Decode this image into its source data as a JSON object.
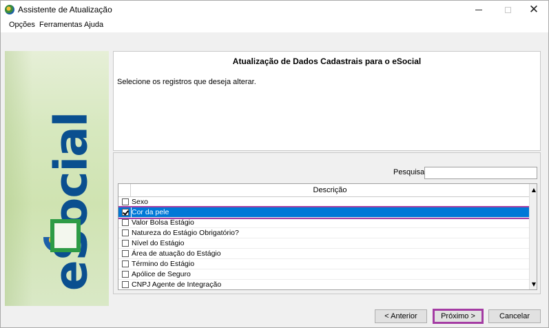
{
  "window": {
    "title": "Assistente de Atualização",
    "minimize": "—",
    "maximize": "",
    "close": "✕"
  },
  "menu": {
    "items": [
      "Opções",
      "Ferramentas",
      "Ajuda"
    ]
  },
  "banner": {
    "logo_text": "eSocial"
  },
  "info": {
    "title": "Atualização de Dados Cadastrais para o eSocial",
    "subtitle": "Selecione os registros que deseja alterar."
  },
  "search": {
    "label": "Pesquisa:",
    "value": ""
  },
  "grid": {
    "column_header": "Descrição",
    "rows": [
      {
        "label": "Sexo",
        "checked": false,
        "selected": false
      },
      {
        "label": "Cor da pele",
        "checked": true,
        "selected": true
      },
      {
        "label": "Valor Bolsa Estágio",
        "checked": false,
        "selected": false
      },
      {
        "label": "Natureza do Estágio Obrigatório?",
        "checked": false,
        "selected": false
      },
      {
        "label": "Nível do Estágio",
        "checked": false,
        "selected": false
      },
      {
        "label": "Área de atuação do Estágio",
        "checked": false,
        "selected": false
      },
      {
        "label": "Término do Estágio",
        "checked": false,
        "selected": false
      },
      {
        "label": "Apólice de Seguro",
        "checked": false,
        "selected": false
      },
      {
        "label": "CNPJ Agente de Integração",
        "checked": false,
        "selected": false
      }
    ],
    "scroll_up": "▲",
    "scroll_down": "▼"
  },
  "buttons": {
    "previous": "< Anterior",
    "next": "Próximo >",
    "cancel": "Cancelar"
  },
  "colors": {
    "selection": "#0078d7",
    "highlight": "#a43ca3",
    "brand_blue": "#0a4f8f",
    "brand_green": "#2d9b46"
  }
}
